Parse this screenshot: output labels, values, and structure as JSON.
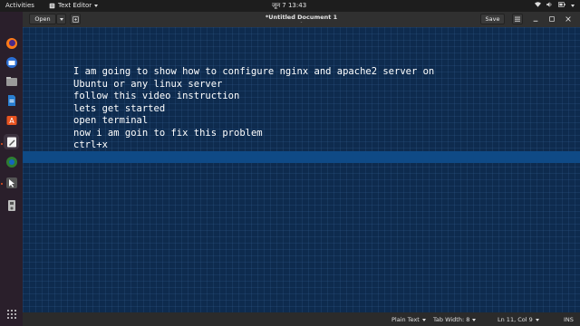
{
  "topbar": {
    "activities": "Activities",
    "app_name": "Text Editor",
    "clock": "जून 7  13:43"
  },
  "dock": {
    "items": [
      {
        "name": "firefox-icon",
        "active": false
      },
      {
        "name": "thunderbird-icon",
        "active": false
      },
      {
        "name": "files-icon",
        "active": false
      },
      {
        "name": "writer-icon",
        "active": false
      },
      {
        "name": "software-icon",
        "active": false
      },
      {
        "name": "text-editor-icon",
        "active": true
      },
      {
        "name": "browser-icon",
        "active": false
      },
      {
        "name": "screenshot-icon",
        "active": false
      },
      {
        "name": "usb-drive-icon",
        "active": false
      }
    ],
    "apps_grid_icon": "apps-grid-icon"
  },
  "header": {
    "open_label": "Open",
    "title": "*Untitled Document 1",
    "subtitle": "-",
    "save_label": "Save"
  },
  "editor": {
    "lines": [
      "I am going to show how to configure nginx and apache2 server on",
      "Ubuntu or any linux server",
      "follow this video instruction",
      "lets get started",
      "open terminal",
      "now i am goin to fix this problem",
      "ctrl+x"
    ],
    "background": "#0e2b4e",
    "current_line_color": "#0f4a86"
  },
  "statusbar": {
    "language": "Plain Text",
    "tab_width": "Tab Width: 8",
    "position": "Ln 11, Col 9",
    "mode": "INS"
  }
}
